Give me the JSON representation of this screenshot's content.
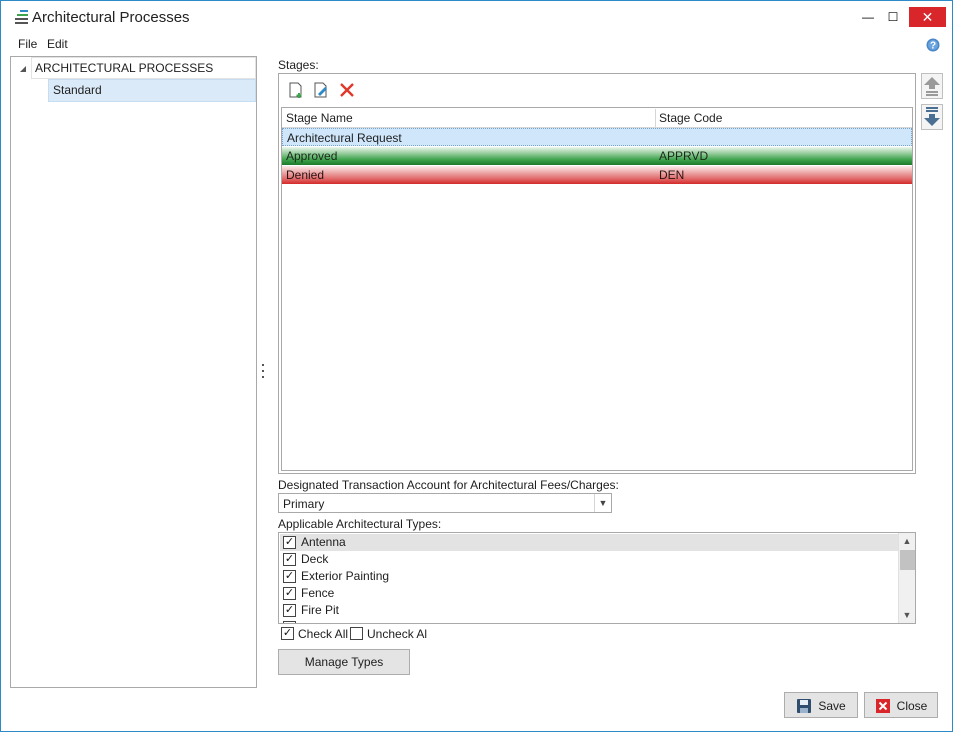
{
  "window": {
    "title": "Architectural Processes",
    "controls": {
      "minimize": "—",
      "maximize": "☐",
      "close": "✕"
    }
  },
  "menu": {
    "file": "File",
    "edit": "Edit"
  },
  "tree": {
    "root": "ARCHITECTURAL PROCESSES",
    "children": [
      "Standard"
    ]
  },
  "stages": {
    "label": "Stages:",
    "columns": {
      "name": "Stage Name",
      "code": "Stage Code"
    },
    "rows": [
      {
        "name": "Architectural Request",
        "code": ""
      },
      {
        "name": "Approved",
        "code": "APPRVD"
      },
      {
        "name": "Denied",
        "code": "DEN"
      }
    ]
  },
  "account": {
    "label": "Designated Transaction Account for Architectural Fees/Charges:",
    "value": "Primary"
  },
  "types": {
    "label": "Applicable Architectural Types:",
    "items": [
      {
        "label": "Antenna",
        "checked": true
      },
      {
        "label": "Deck",
        "checked": true
      },
      {
        "label": "Exterior Painting",
        "checked": true
      },
      {
        "label": "Fence",
        "checked": true
      },
      {
        "label": "Fire Pit",
        "checked": true
      }
    ],
    "check_all": "Check All",
    "uncheck_all": "Uncheck Al"
  },
  "buttons": {
    "manage_types": "Manage Types",
    "save": "Save",
    "close": "Close"
  },
  "colors": {
    "accent": "#2d89c7",
    "approved": "#3fa34d",
    "denied": "#d42a2a",
    "selection": "#cfe6fb"
  }
}
